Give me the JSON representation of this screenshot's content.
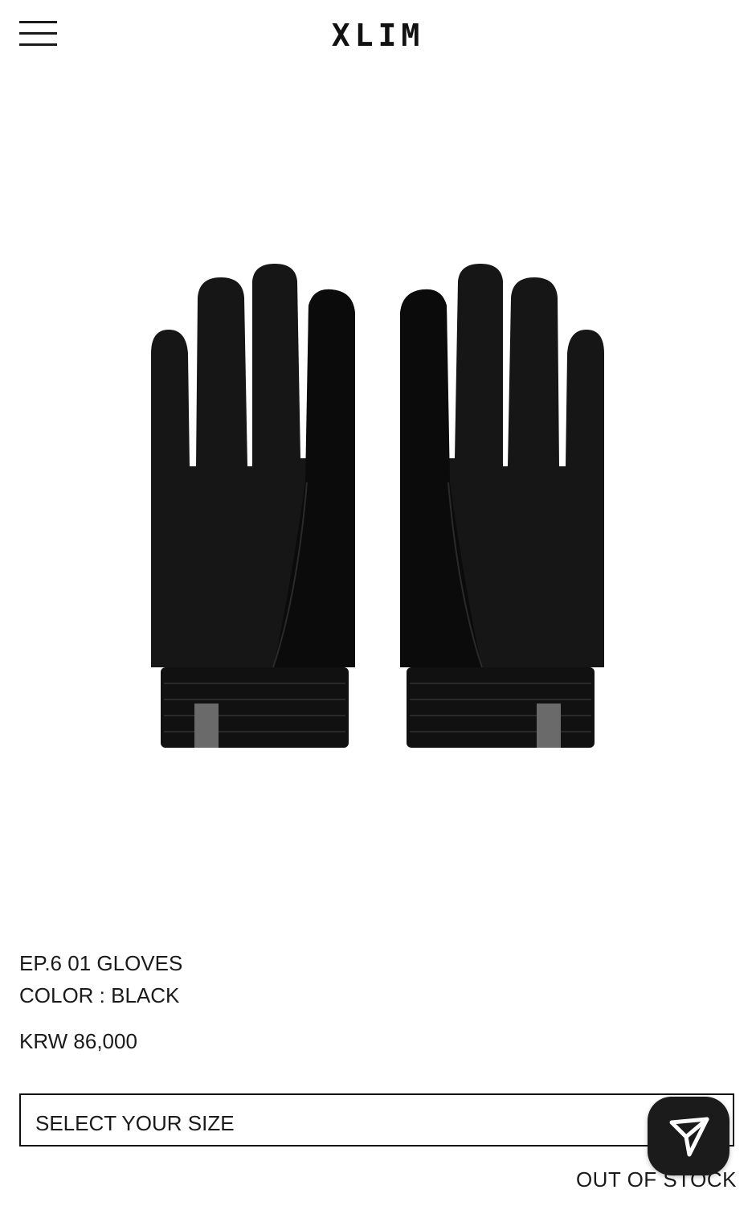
{
  "header": {
    "logo": "XLIM",
    "menu_icon": "hamburger-menu-icon"
  },
  "product": {
    "image_icon": "gloves-image",
    "name": "EP.6 01 GLOVES",
    "color": "COLOR : BLACK",
    "price": "KRW 86,000",
    "size_select": {
      "placeholder": "SELECT YOUR SIZE",
      "icon": "chevron-down-icon"
    },
    "stock_status": "OUT OF STOCK"
  },
  "floating_action": {
    "icon": "send-arrow-icon"
  },
  "colors": {
    "text": "#1a1a1a",
    "background": "#ffffff",
    "glove": "#161616",
    "fab": "#1b1b1b"
  }
}
